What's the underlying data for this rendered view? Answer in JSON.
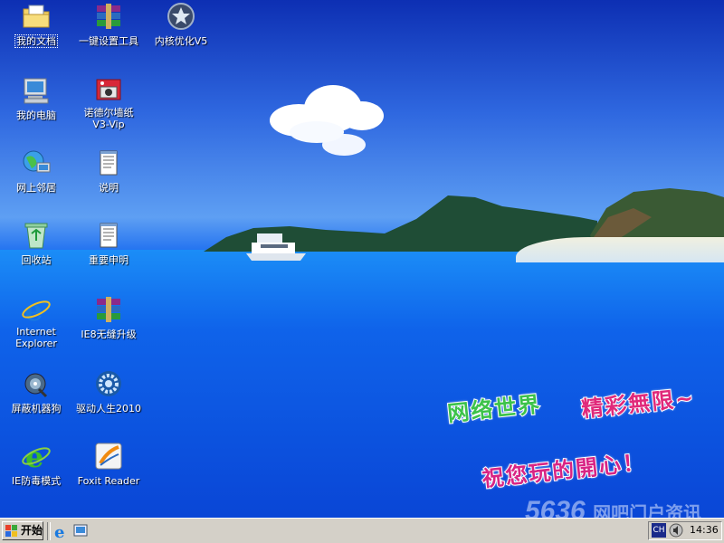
{
  "desktop": {
    "icons": [
      {
        "label": "我的文档"
      },
      {
        "label": "一键设置工具"
      },
      {
        "label": "内核优化V5"
      },
      {
        "label": "我的电脑"
      },
      {
        "label": "诺德尔墙纸\nV3-Vip"
      },
      {
        "label": "网上邻居"
      },
      {
        "label": "说明"
      },
      {
        "label": "回收站"
      },
      {
        "label": "重要申明"
      },
      {
        "label": "Internet\nExplorer"
      },
      {
        "label": "IE8无缝升级"
      },
      {
        "label": "屏蔽机器狗"
      },
      {
        "label": "驱动人生2010"
      },
      {
        "label": "IE防毒模式"
      },
      {
        "label": "Foxit Reader"
      }
    ]
  },
  "wallpaper": {
    "promo_line1a": "网络世界",
    "promo_line1b": "精彩無限~",
    "promo_line2": "祝您玩的開心！",
    "watermark": "5636",
    "watermark_text": "网吧门户资讯"
  },
  "taskbar": {
    "start_label": "开始",
    "input_method": "CH",
    "clock": "14:36"
  },
  "colors": {
    "taskbar_bg": "#d4d0c8",
    "sky_top": "#0d2fb3",
    "sea": "#0f63ea"
  }
}
